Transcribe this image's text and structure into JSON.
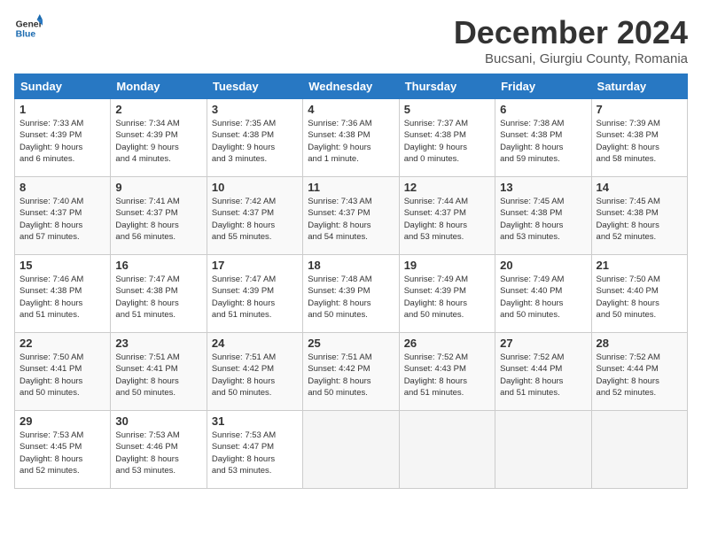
{
  "header": {
    "logo_text_general": "General",
    "logo_text_blue": "Blue",
    "title": "December 2024",
    "subtitle": "Bucsani, Giurgiu County, Romania"
  },
  "calendar": {
    "days_of_week": [
      "Sunday",
      "Monday",
      "Tuesday",
      "Wednesday",
      "Thursday",
      "Friday",
      "Saturday"
    ],
    "weeks": [
      [
        {
          "day": "",
          "info": "",
          "empty": true
        },
        {
          "day": "",
          "info": "",
          "empty": true
        },
        {
          "day": "",
          "info": "",
          "empty": true
        },
        {
          "day": "",
          "info": "",
          "empty": true
        },
        {
          "day": "",
          "info": "",
          "empty": true
        },
        {
          "day": "",
          "info": "",
          "empty": true
        },
        {
          "day": "",
          "info": "",
          "empty": true
        }
      ],
      [
        {
          "day": "1",
          "info": "Sunrise: 7:33 AM\nSunset: 4:39 PM\nDaylight: 9 hours\nand 6 minutes.",
          "empty": false
        },
        {
          "day": "2",
          "info": "Sunrise: 7:34 AM\nSunset: 4:39 PM\nDaylight: 9 hours\nand 4 minutes.",
          "empty": false
        },
        {
          "day": "3",
          "info": "Sunrise: 7:35 AM\nSunset: 4:38 PM\nDaylight: 9 hours\nand 3 minutes.",
          "empty": false
        },
        {
          "day": "4",
          "info": "Sunrise: 7:36 AM\nSunset: 4:38 PM\nDaylight: 9 hours\nand 1 minute.",
          "empty": false
        },
        {
          "day": "5",
          "info": "Sunrise: 7:37 AM\nSunset: 4:38 PM\nDaylight: 9 hours\nand 0 minutes.",
          "empty": false
        },
        {
          "day": "6",
          "info": "Sunrise: 7:38 AM\nSunset: 4:38 PM\nDaylight: 8 hours\nand 59 minutes.",
          "empty": false
        },
        {
          "day": "7",
          "info": "Sunrise: 7:39 AM\nSunset: 4:38 PM\nDaylight: 8 hours\nand 58 minutes.",
          "empty": false
        }
      ],
      [
        {
          "day": "8",
          "info": "Sunrise: 7:40 AM\nSunset: 4:37 PM\nDaylight: 8 hours\nand 57 minutes.",
          "empty": false
        },
        {
          "day": "9",
          "info": "Sunrise: 7:41 AM\nSunset: 4:37 PM\nDaylight: 8 hours\nand 56 minutes.",
          "empty": false
        },
        {
          "day": "10",
          "info": "Sunrise: 7:42 AM\nSunset: 4:37 PM\nDaylight: 8 hours\nand 55 minutes.",
          "empty": false
        },
        {
          "day": "11",
          "info": "Sunrise: 7:43 AM\nSunset: 4:37 PM\nDaylight: 8 hours\nand 54 minutes.",
          "empty": false
        },
        {
          "day": "12",
          "info": "Sunrise: 7:44 AM\nSunset: 4:37 PM\nDaylight: 8 hours\nand 53 minutes.",
          "empty": false
        },
        {
          "day": "13",
          "info": "Sunrise: 7:45 AM\nSunset: 4:38 PM\nDaylight: 8 hours\nand 53 minutes.",
          "empty": false
        },
        {
          "day": "14",
          "info": "Sunrise: 7:45 AM\nSunset: 4:38 PM\nDaylight: 8 hours\nand 52 minutes.",
          "empty": false
        }
      ],
      [
        {
          "day": "15",
          "info": "Sunrise: 7:46 AM\nSunset: 4:38 PM\nDaylight: 8 hours\nand 51 minutes.",
          "empty": false
        },
        {
          "day": "16",
          "info": "Sunrise: 7:47 AM\nSunset: 4:38 PM\nDaylight: 8 hours\nand 51 minutes.",
          "empty": false
        },
        {
          "day": "17",
          "info": "Sunrise: 7:47 AM\nSunset: 4:39 PM\nDaylight: 8 hours\nand 51 minutes.",
          "empty": false
        },
        {
          "day": "18",
          "info": "Sunrise: 7:48 AM\nSunset: 4:39 PM\nDaylight: 8 hours\nand 50 minutes.",
          "empty": false
        },
        {
          "day": "19",
          "info": "Sunrise: 7:49 AM\nSunset: 4:39 PM\nDaylight: 8 hours\nand 50 minutes.",
          "empty": false
        },
        {
          "day": "20",
          "info": "Sunrise: 7:49 AM\nSunset: 4:40 PM\nDaylight: 8 hours\nand 50 minutes.",
          "empty": false
        },
        {
          "day": "21",
          "info": "Sunrise: 7:50 AM\nSunset: 4:40 PM\nDaylight: 8 hours\nand 50 minutes.",
          "empty": false
        }
      ],
      [
        {
          "day": "22",
          "info": "Sunrise: 7:50 AM\nSunset: 4:41 PM\nDaylight: 8 hours\nand 50 minutes.",
          "empty": false
        },
        {
          "day": "23",
          "info": "Sunrise: 7:51 AM\nSunset: 4:41 PM\nDaylight: 8 hours\nand 50 minutes.",
          "empty": false
        },
        {
          "day": "24",
          "info": "Sunrise: 7:51 AM\nSunset: 4:42 PM\nDaylight: 8 hours\nand 50 minutes.",
          "empty": false
        },
        {
          "day": "25",
          "info": "Sunrise: 7:51 AM\nSunset: 4:42 PM\nDaylight: 8 hours\nand 50 minutes.",
          "empty": false
        },
        {
          "day": "26",
          "info": "Sunrise: 7:52 AM\nSunset: 4:43 PM\nDaylight: 8 hours\nand 51 minutes.",
          "empty": false
        },
        {
          "day": "27",
          "info": "Sunrise: 7:52 AM\nSunset: 4:44 PM\nDaylight: 8 hours\nand 51 minutes.",
          "empty": false
        },
        {
          "day": "28",
          "info": "Sunrise: 7:52 AM\nSunset: 4:44 PM\nDaylight: 8 hours\nand 52 minutes.",
          "empty": false
        }
      ],
      [
        {
          "day": "29",
          "info": "Sunrise: 7:53 AM\nSunset: 4:45 PM\nDaylight: 8 hours\nand 52 minutes.",
          "empty": false
        },
        {
          "day": "30",
          "info": "Sunrise: 7:53 AM\nSunset: 4:46 PM\nDaylight: 8 hours\nand 53 minutes.",
          "empty": false
        },
        {
          "day": "31",
          "info": "Sunrise: 7:53 AM\nSunset: 4:47 PM\nDaylight: 8 hours\nand 53 minutes.",
          "empty": false
        },
        {
          "day": "",
          "info": "",
          "empty": true
        },
        {
          "day": "",
          "info": "",
          "empty": true
        },
        {
          "day": "",
          "info": "",
          "empty": true
        },
        {
          "day": "",
          "info": "",
          "empty": true
        }
      ]
    ]
  }
}
